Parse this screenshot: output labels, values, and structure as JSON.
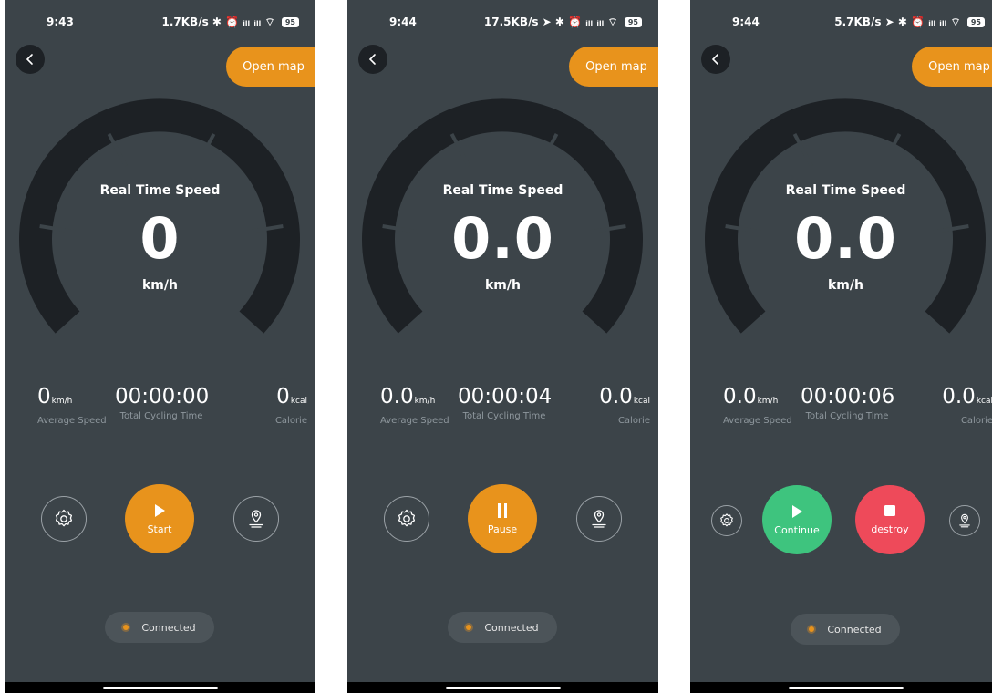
{
  "colors": {
    "background": "#3c4449",
    "accent": "#e8931c",
    "gauge": "#1d2125",
    "continue": "#3ec47e",
    "destroy": "#ee4a5a",
    "connected_dot": "#e8931c"
  },
  "screens": [
    {
      "status": {
        "time": "9:43",
        "right": "1.7KB/s ✱ ⏰ ᵢₗₗ ᵢₗₗ ⌔",
        "battery": "95"
      },
      "open_map": "Open map",
      "speed": {
        "title": "Real Time Speed",
        "value": "0",
        "unit": "km/h"
      },
      "stats": {
        "avg_value": "0",
        "avg_unit": "km/h",
        "avg_label": "Average Speed",
        "time_value": "00:00:00",
        "time_label": "Total Cycling Time",
        "cal_value": "0",
        "cal_unit": "kcal",
        "cal_label": "Calorie"
      },
      "buttons": {
        "primary": "Start"
      },
      "connection": "Connected"
    },
    {
      "status": {
        "time": "9:44",
        "right": "17.5KB/s ➤ ✱ ⏰ ᵢₗₗ ᵢₗₗ ⌔",
        "battery": "95"
      },
      "open_map": "Open map",
      "speed": {
        "title": "Real Time Speed",
        "value": "0.0",
        "unit": "km/h"
      },
      "stats": {
        "avg_value": "0.0",
        "avg_unit": "km/h",
        "avg_label": "Average Speed",
        "time_value": "00:00:04",
        "time_label": "Total Cycling Time",
        "cal_value": "0.0",
        "cal_unit": "kcal",
        "cal_label": "Calorie"
      },
      "buttons": {
        "primary": "Pause"
      },
      "connection": "Connected"
    },
    {
      "status": {
        "time": "9:44",
        "right": "5.7KB/s ➤ ✱ ⏰ ᵢₗₗ ᵢₗₗ ⌔",
        "battery": "95"
      },
      "open_map": "Open map",
      "speed": {
        "title": "Real Time Speed",
        "value": "0.0",
        "unit": "km/h"
      },
      "stats": {
        "avg_value": "0.0",
        "avg_unit": "km/h",
        "avg_label": "Average Speed",
        "time_value": "00:00:06",
        "time_label": "Total Cycling Time",
        "cal_value": "0.0",
        "cal_unit": "kcal",
        "cal_label": "Calorie"
      },
      "buttons": {
        "continue": "Continue",
        "destroy": "destroy"
      },
      "connection": "Connected"
    }
  ]
}
